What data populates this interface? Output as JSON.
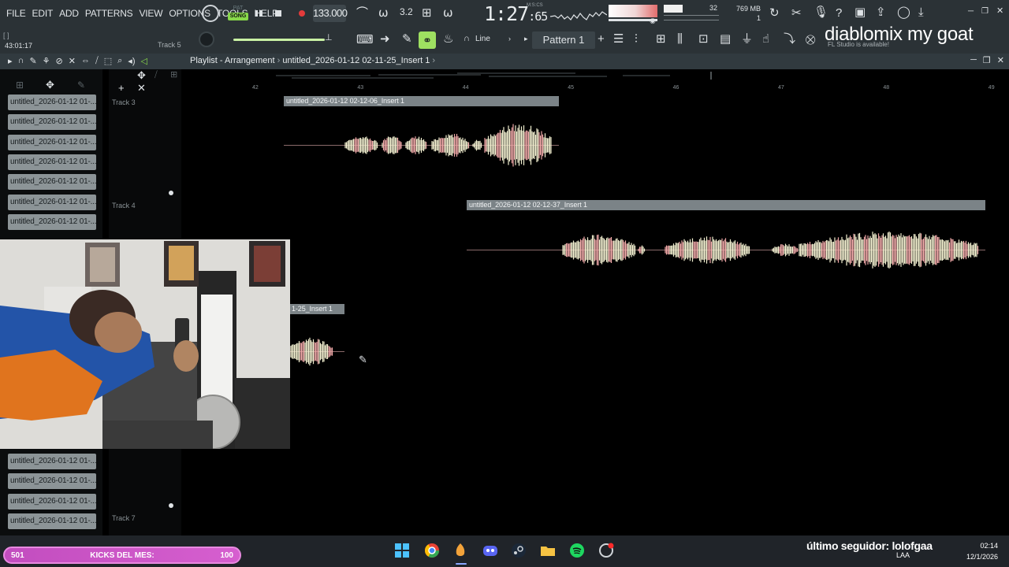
{
  "menu": [
    "FILE",
    "EDIT",
    "ADD",
    "PATTERNS",
    "VIEW",
    "OPTIONS",
    "TOOLS",
    "HELP"
  ],
  "transport": {
    "pat_label": "PAT",
    "song_label": "SONG",
    "tempo": "133.000",
    "time_main": "1:27",
    "time_sub": ":65",
    "time_unit": "M:S:CS"
  },
  "monitor": {
    "polyphony": "32",
    "memory": "769 MB",
    "cpu": "1"
  },
  "hint": {
    "line": "[ ]",
    "time": "43:01:17",
    "track": "Track 5"
  },
  "toolbar": {
    "snap_mode": "Line",
    "pattern": "Pattern 1"
  },
  "overlay": {
    "title": "diablomix my goat",
    "update_note": "FL Studio is available!"
  },
  "playlist": {
    "breadcrumb_root": "Playlist - Arrangement",
    "breadcrumb_sep": "›",
    "breadcrumb_item": "untitled_2026-01-12 02-11-25_Insert 1",
    "bars": [
      "42",
      "43",
      "44",
      "45",
      "46",
      "47",
      "48",
      "49"
    ],
    "browser_clips": [
      "untitled_2026-01-12 01-...",
      "untitled_2026-01-12 01-...",
      "untitled_2026-01-12 01-...",
      "untitled_2026-01-12 01-...",
      "untitled_2026-01-12 01-...",
      "untitled_2026-01-12 01-...",
      "untitled_2026-01-12 01-..."
    ],
    "browser_clips_bottom": [
      "untitled_2026-01-12 01-...",
      "untitled_2026-01-12 01-...",
      "untitled_2026-01-12 01-...",
      "untitled_2026-01-12 01-..."
    ],
    "tracks": [
      "Track 3",
      "Track 4",
      "Track 7"
    ],
    "clips": [
      {
        "label": "untitled_2026-01-12 02-12-06_Insert 1"
      },
      {
        "label": "untitled_2026-01-12 02-12-37_Insert 1"
      },
      {
        "label": "1-25_Insert 1"
      }
    ]
  },
  "taskbar": {
    "kicks_count": "501",
    "kicks_label": "KICKS DEL MES:",
    "kicks_goal": "100",
    "follower": "último seguidor: lolofgaa",
    "lang": "LAA",
    "time": "02:14",
    "date": "12/1/2026"
  },
  "colors": {
    "song_active": "#88d84a",
    "record": "#e43b3b",
    "wave_light": "#f2f0d0",
    "wave_pink": "#f0a8a8",
    "kicks_bg": "#c24dbf"
  }
}
